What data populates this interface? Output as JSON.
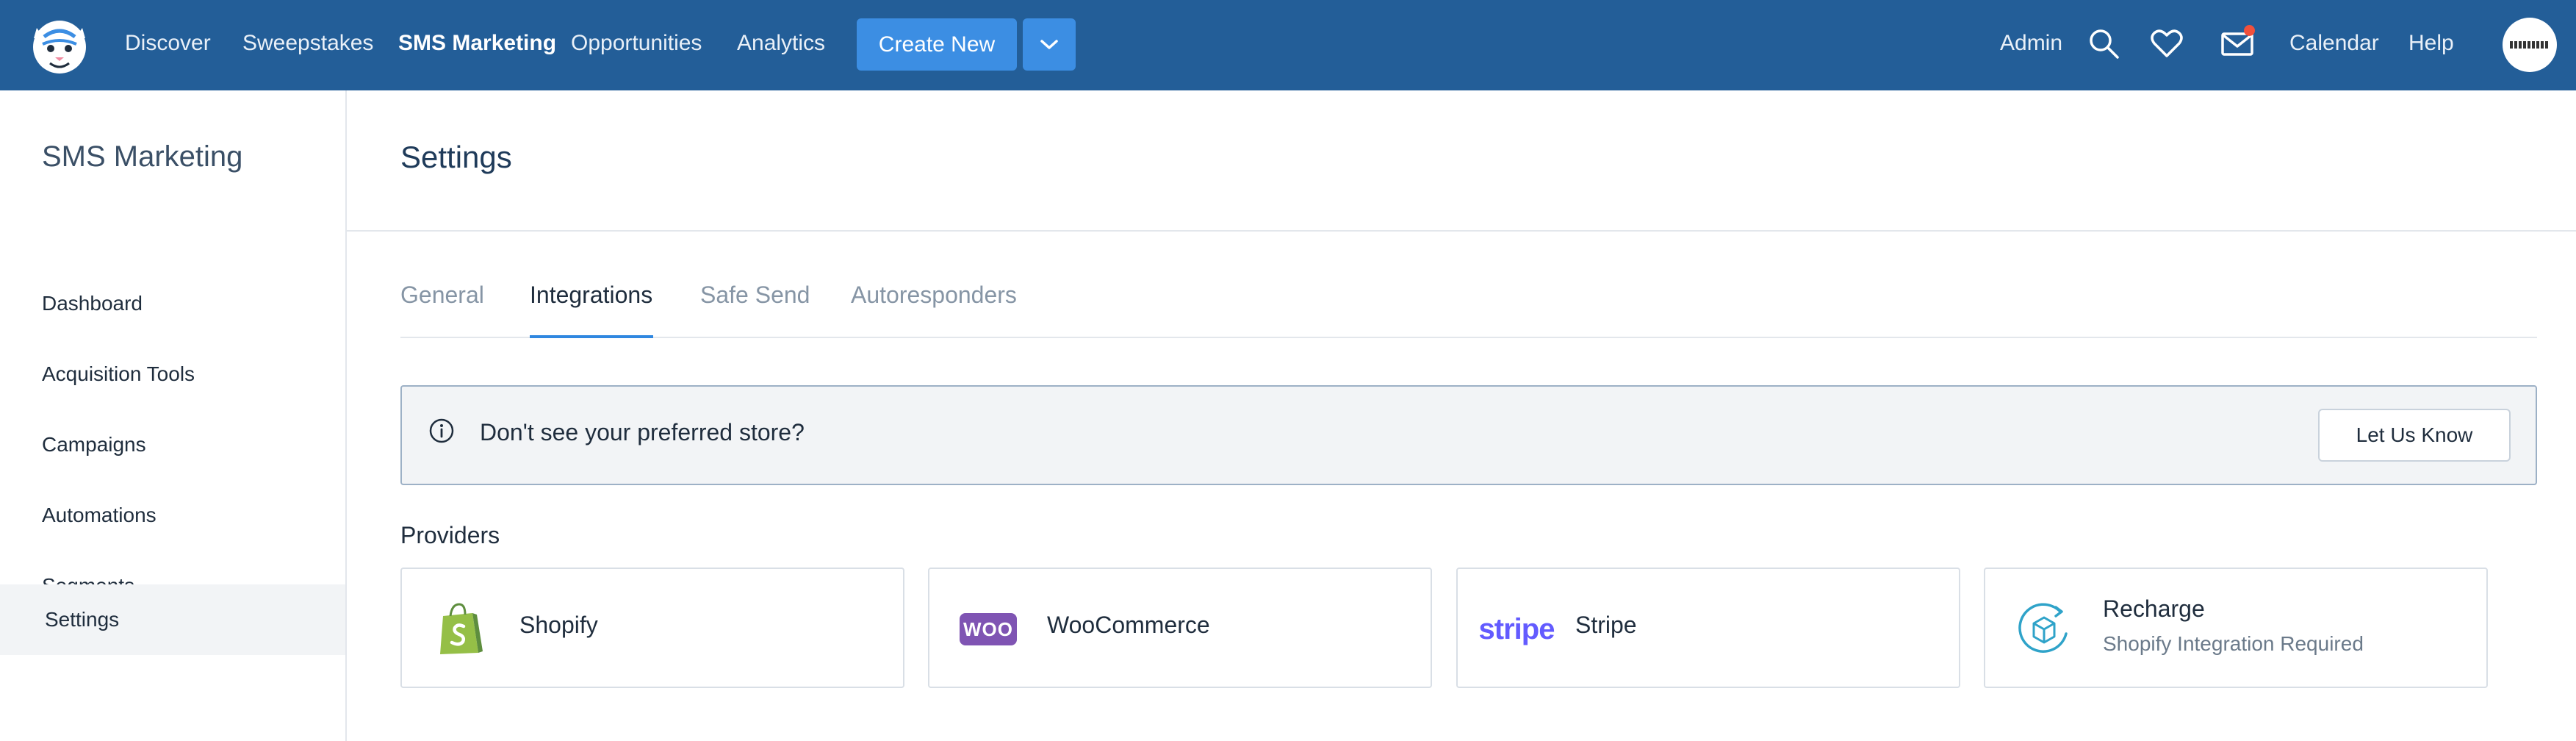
{
  "topnav": {
    "links": [
      "Discover",
      "Sweepstakes",
      "SMS Marketing",
      "Opportunities",
      "Analytics"
    ],
    "active": "SMS Marketing",
    "create_label": "Create New",
    "right_links": {
      "admin": "Admin",
      "calendar": "Calendar",
      "help": "Help"
    }
  },
  "sidebar": {
    "title": "SMS Marketing",
    "items": [
      "Dashboard",
      "Acquisition Tools",
      "Campaigns",
      "Automations",
      "Segments",
      "Settings"
    ],
    "active": "Settings"
  },
  "main": {
    "title": "Settings",
    "tabs": [
      "General",
      "Integrations",
      "Safe Send",
      "Autoresponders"
    ],
    "active_tab": "Integrations",
    "banner": {
      "text": "Don't see your preferred store?",
      "button": "Let Us Know"
    },
    "providers_title": "Providers",
    "providers": [
      {
        "name": "Shopify",
        "note": ""
      },
      {
        "name": "WooCommerce",
        "note": ""
      },
      {
        "name": "Stripe",
        "note": ""
      },
      {
        "name": "Recharge",
        "note": "Shopify Integration Required"
      }
    ],
    "logo_text": {
      "woo": "WOO",
      "stripe": "stripe"
    }
  },
  "colors": {
    "nav_bg": "#235e98",
    "accent": "#3c8ee3",
    "tab_underline": "#2f87e0",
    "notification": "#f0503c"
  }
}
